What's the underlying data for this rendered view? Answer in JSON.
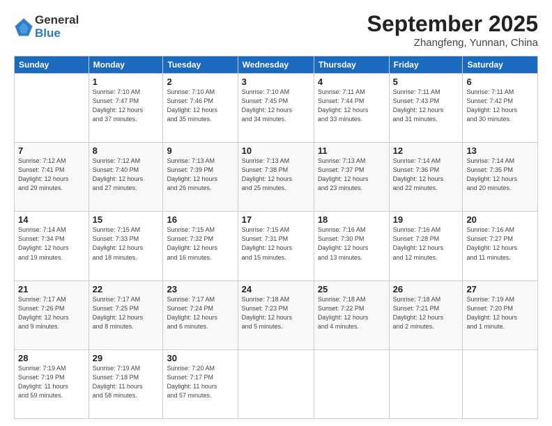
{
  "header": {
    "logo_general": "General",
    "logo_blue": "Blue",
    "month_title": "September 2025",
    "location": "Zhangfeng, Yunnan, China"
  },
  "calendar": {
    "headers": [
      "Sunday",
      "Monday",
      "Tuesday",
      "Wednesday",
      "Thursday",
      "Friday",
      "Saturday"
    ],
    "weeks": [
      [
        {
          "day": "",
          "info": ""
        },
        {
          "day": "1",
          "info": "Sunrise: 7:10 AM\nSunset: 7:47 PM\nDaylight: 12 hours\nand 37 minutes."
        },
        {
          "day": "2",
          "info": "Sunrise: 7:10 AM\nSunset: 7:46 PM\nDaylight: 12 hours\nand 35 minutes."
        },
        {
          "day": "3",
          "info": "Sunrise: 7:10 AM\nSunset: 7:45 PM\nDaylight: 12 hours\nand 34 minutes."
        },
        {
          "day": "4",
          "info": "Sunrise: 7:11 AM\nSunset: 7:44 PM\nDaylight: 12 hours\nand 33 minutes."
        },
        {
          "day": "5",
          "info": "Sunrise: 7:11 AM\nSunset: 7:43 PM\nDaylight: 12 hours\nand 31 minutes."
        },
        {
          "day": "6",
          "info": "Sunrise: 7:11 AM\nSunset: 7:42 PM\nDaylight: 12 hours\nand 30 minutes."
        }
      ],
      [
        {
          "day": "7",
          "info": "Sunrise: 7:12 AM\nSunset: 7:41 PM\nDaylight: 12 hours\nand 29 minutes."
        },
        {
          "day": "8",
          "info": "Sunrise: 7:12 AM\nSunset: 7:40 PM\nDaylight: 12 hours\nand 27 minutes."
        },
        {
          "day": "9",
          "info": "Sunrise: 7:13 AM\nSunset: 7:39 PM\nDaylight: 12 hours\nand 26 minutes."
        },
        {
          "day": "10",
          "info": "Sunrise: 7:13 AM\nSunset: 7:38 PM\nDaylight: 12 hours\nand 25 minutes."
        },
        {
          "day": "11",
          "info": "Sunrise: 7:13 AM\nSunset: 7:37 PM\nDaylight: 12 hours\nand 23 minutes."
        },
        {
          "day": "12",
          "info": "Sunrise: 7:14 AM\nSunset: 7:36 PM\nDaylight: 12 hours\nand 22 minutes."
        },
        {
          "day": "13",
          "info": "Sunrise: 7:14 AM\nSunset: 7:35 PM\nDaylight: 12 hours\nand 20 minutes."
        }
      ],
      [
        {
          "day": "14",
          "info": "Sunrise: 7:14 AM\nSunset: 7:34 PM\nDaylight: 12 hours\nand 19 minutes."
        },
        {
          "day": "15",
          "info": "Sunrise: 7:15 AM\nSunset: 7:33 PM\nDaylight: 12 hours\nand 18 minutes."
        },
        {
          "day": "16",
          "info": "Sunrise: 7:15 AM\nSunset: 7:32 PM\nDaylight: 12 hours\nand 16 minutes."
        },
        {
          "day": "17",
          "info": "Sunrise: 7:15 AM\nSunset: 7:31 PM\nDaylight: 12 hours\nand 15 minutes."
        },
        {
          "day": "18",
          "info": "Sunrise: 7:16 AM\nSunset: 7:30 PM\nDaylight: 12 hours\nand 13 minutes."
        },
        {
          "day": "19",
          "info": "Sunrise: 7:16 AM\nSunset: 7:28 PM\nDaylight: 12 hours\nand 12 minutes."
        },
        {
          "day": "20",
          "info": "Sunrise: 7:16 AM\nSunset: 7:27 PM\nDaylight: 12 hours\nand 11 minutes."
        }
      ],
      [
        {
          "day": "21",
          "info": "Sunrise: 7:17 AM\nSunset: 7:26 PM\nDaylight: 12 hours\nand 9 minutes."
        },
        {
          "day": "22",
          "info": "Sunrise: 7:17 AM\nSunset: 7:25 PM\nDaylight: 12 hours\nand 8 minutes."
        },
        {
          "day": "23",
          "info": "Sunrise: 7:17 AM\nSunset: 7:24 PM\nDaylight: 12 hours\nand 6 minutes."
        },
        {
          "day": "24",
          "info": "Sunrise: 7:18 AM\nSunset: 7:23 PM\nDaylight: 12 hours\nand 5 minutes."
        },
        {
          "day": "25",
          "info": "Sunrise: 7:18 AM\nSunset: 7:22 PM\nDaylight: 12 hours\nand 4 minutes."
        },
        {
          "day": "26",
          "info": "Sunrise: 7:18 AM\nSunset: 7:21 PM\nDaylight: 12 hours\nand 2 minutes."
        },
        {
          "day": "27",
          "info": "Sunrise: 7:19 AM\nSunset: 7:20 PM\nDaylight: 12 hours\nand 1 minute."
        }
      ],
      [
        {
          "day": "28",
          "info": "Sunrise: 7:19 AM\nSunset: 7:19 PM\nDaylight: 11 hours\nand 59 minutes."
        },
        {
          "day": "29",
          "info": "Sunrise: 7:19 AM\nSunset: 7:18 PM\nDaylight: 11 hours\nand 58 minutes."
        },
        {
          "day": "30",
          "info": "Sunrise: 7:20 AM\nSunset: 7:17 PM\nDaylight: 11 hours\nand 57 minutes."
        },
        {
          "day": "",
          "info": ""
        },
        {
          "day": "",
          "info": ""
        },
        {
          "day": "",
          "info": ""
        },
        {
          "day": "",
          "info": ""
        }
      ]
    ]
  }
}
